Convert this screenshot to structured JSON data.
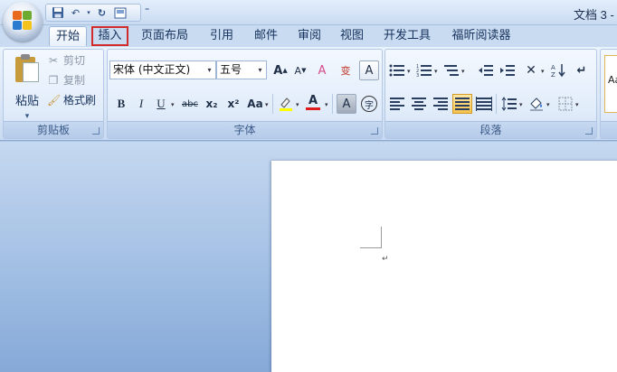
{
  "titlebar": {
    "doc_title": "文档 3 -",
    "qat_dropdown": "⁼"
  },
  "tabs": [
    {
      "label": "开始",
      "active": true
    },
    {
      "label": "插入",
      "highlighted": true
    },
    {
      "label": "页面布局"
    },
    {
      "label": "引用"
    },
    {
      "label": "邮件"
    },
    {
      "label": "审阅"
    },
    {
      "label": "视图"
    },
    {
      "label": "开发工具"
    },
    {
      "label": "福昕阅读器"
    }
  ],
  "clipboard": {
    "paste": "粘贴",
    "cut": "剪切",
    "copy": "复制",
    "format_painter": "格式刷",
    "group_label": "剪贴板"
  },
  "font": {
    "font_name": "宋体 (中文正文)",
    "font_size": "五号",
    "group_label": "字体",
    "bold": "B",
    "italic": "I",
    "underline": "U",
    "strikethrough": "abc",
    "subscript": "x₂",
    "superscript": "x²",
    "change_case": "Aa",
    "font_color": "A",
    "char_shading": "A",
    "enclose_char": "字",
    "grow": "A",
    "shrink": "A",
    "clear": "A",
    "phonetic": "变",
    "border_char": "A"
  },
  "paragraph": {
    "group_label": "段落"
  },
  "colors": {
    "highlight": "#ffff00",
    "font_color": "#e01b1b",
    "tab_highlight_border": "#d22b2b",
    "ribbon_bg": "#dbe7f7"
  }
}
